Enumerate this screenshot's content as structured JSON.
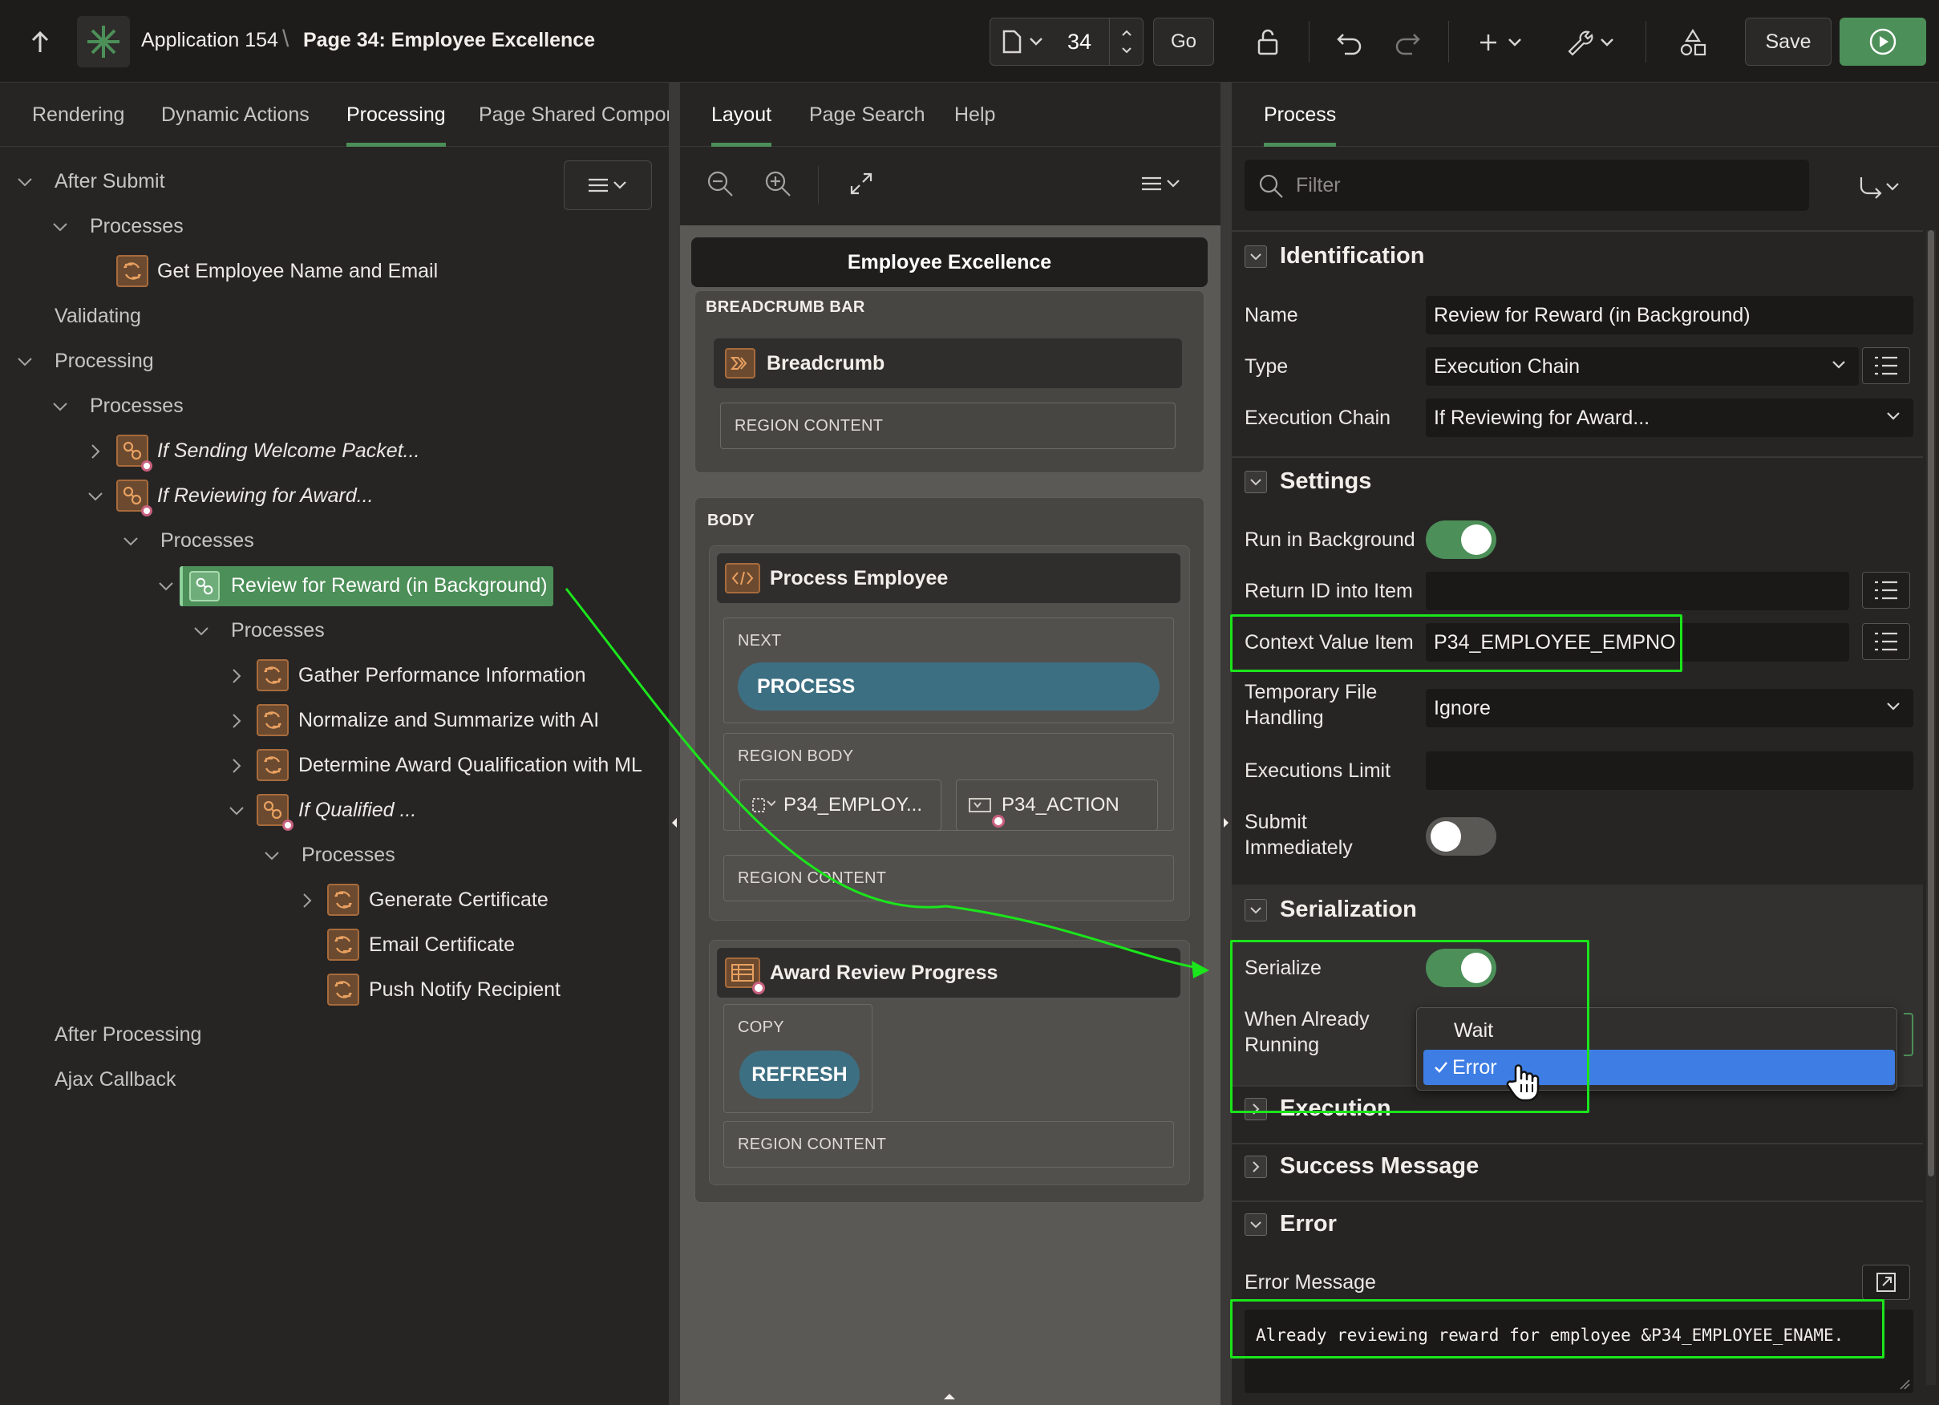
{
  "header": {
    "app_title": "Application 154",
    "separator": "\\",
    "page_title": "Page 34: Employee Excellence",
    "page_number": "34",
    "go_label": "Go",
    "save_label": "Save"
  },
  "left_tabs": [
    "Rendering",
    "Dynamic Actions",
    "Processing",
    "Page Shared Compon"
  ],
  "left_tabs_active": "Processing",
  "center_tabs": [
    "Layout",
    "Page Search",
    "Help"
  ],
  "right_tabs": [
    "Process"
  ],
  "tree": {
    "after_submit": "After Submit",
    "processes_1": "Processes",
    "get_employee": "Get Employee Name and Email",
    "validating": "Validating",
    "processing": "Processing",
    "processes_2": "Processes",
    "if_sending": "If Sending Welcome Packet...",
    "if_reviewing": "If Reviewing for Award...",
    "processes_3": "Processes",
    "review_for_reward": "Review for Reward (in Background)",
    "processes_4": "Processes",
    "gather_performance": "Gather Performance Information",
    "normalize": "Normalize and Summarize with AI",
    "determine_award": "Determine Award Qualification with ML",
    "if_qualified": "If Qualified ...",
    "processes_5": "Processes",
    "generate_certificate": "Generate Certificate",
    "email_certificate": "Email Certificate",
    "push_notify": "Push Notify Recipient",
    "after_processing": "After Processing",
    "ajax_callback": "Ajax Callback"
  },
  "layout": {
    "page_name": "Employee Excellence",
    "breadcrumb_bar": "BREADCRUMB BAR",
    "breadcrumb": "Breadcrumb",
    "region_content": "REGION CONTENT",
    "body": "BODY",
    "process_employee": "Process Employee",
    "next": "NEXT",
    "process_button": "PROCESS",
    "region_body": "REGION BODY",
    "item_empno": "P34_EMPLOY...",
    "item_action": "P34_ACTION",
    "award_review_progress": "Award Review Progress",
    "copy": "COPY",
    "refresh_button": "REFRESH"
  },
  "properties": {
    "filter_placeholder": "Filter",
    "identification": "Identification",
    "name_label": "Name",
    "name_value": "Review for Reward (in Background)",
    "type_label": "Type",
    "type_value": "Execution Chain",
    "execution_chain_label": "Execution Chain",
    "execution_chain_value": "If Reviewing for Award...",
    "settings": "Settings",
    "run_in_background_label": "Run in Background",
    "run_in_background": true,
    "return_id_label": "Return ID into Item",
    "return_id_value": "",
    "context_value_label": "Context Value Item",
    "context_value_value": "P34_EMPLOYEE_EMPNO",
    "temp_file_label_1": "Temporary File",
    "temp_file_label_2": "Handling",
    "temp_file_value": "Ignore",
    "executions_limit_label": "Executions Limit",
    "executions_limit_value": "",
    "submit_immediately_label_1": "Submit",
    "submit_immediately_label_2": "Immediately",
    "submit_immediately": false,
    "serialization": "Serialization",
    "serialize_label": "Serialize",
    "serialize": true,
    "when_running_label_1": "When Already",
    "when_running_label_2": "Running",
    "when_running_options": [
      "Wait",
      "Error"
    ],
    "when_running_selected": "Error",
    "execution": "Execution",
    "success_message": "Success Message",
    "error": "Error",
    "error_message_label": "Error Message",
    "error_message_value": "Already reviewing reward for employee &P34_EMPLOYEE_ENAME."
  },
  "colors": {
    "accent_green": "#4c8f58",
    "highlight_green": "#1be51b",
    "selected_blue": "#3d7de4",
    "process_orange": "#a86b3c",
    "button_teal": "#3d6f82"
  }
}
